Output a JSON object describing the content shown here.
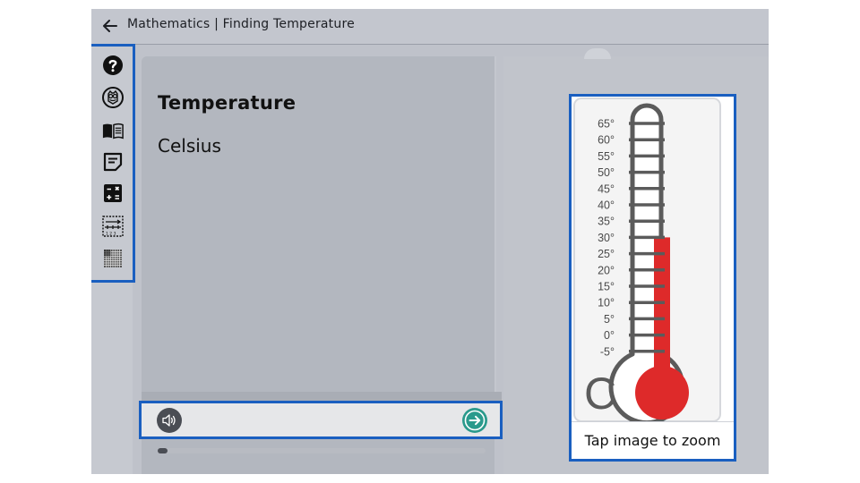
{
  "header": {
    "title": "Mathematics | Finding Temperature",
    "back_icon": "arrow-left-icon"
  },
  "toolbar": {
    "tools": [
      {
        "name": "help",
        "icon": "question-circle-icon"
      },
      {
        "name": "owl",
        "icon": "owl-icon"
      },
      {
        "name": "glossary",
        "icon": "open-book-icon"
      },
      {
        "name": "notes",
        "icon": "note-icon"
      },
      {
        "name": "calculator",
        "icon": "calculator-icon"
      },
      {
        "name": "number-line",
        "icon": "number-line-icon"
      },
      {
        "name": "grid",
        "icon": "grid-icon"
      }
    ]
  },
  "content": {
    "heading": "Temperature",
    "subheading": "Celsius"
  },
  "audio": {
    "speaker_icon": "speaker-icon",
    "next_icon": "arrow-right-circle-icon",
    "progress": 0.03
  },
  "image_panel": {
    "caption": "Tap image to zoom",
    "scale_unit": "C",
    "tick_labels": [
      "65°",
      "60°",
      "55°",
      "50°",
      "45°",
      "40°",
      "35°",
      "30°",
      "25°",
      "20°",
      "15°",
      "10°",
      "5°",
      "0°",
      "-5°"
    ],
    "mercury_reading": 30,
    "mercury_color": "#de2a2a"
  },
  "colors": {
    "highlight": "#1a5fc0",
    "next_button": "#2a9a8c"
  }
}
